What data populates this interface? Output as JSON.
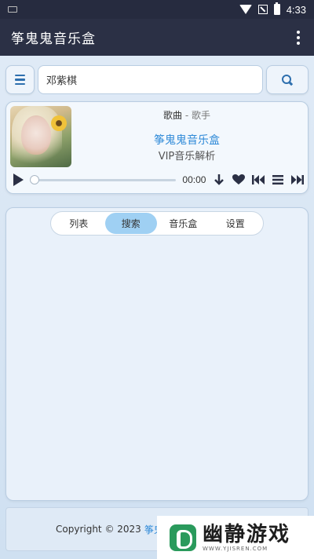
{
  "status_bar": {
    "time": "4:33"
  },
  "app_bar": {
    "title": "筝鬼鬼音乐盒"
  },
  "search": {
    "value": "邓紫棋"
  },
  "player": {
    "song": "歌曲",
    "separator": "-",
    "artist": "歌手",
    "app_name": "筝鬼鬼音乐盒",
    "subtitle": "VIP音乐解析",
    "current_time": "00:00",
    "progress_fraction": 0
  },
  "tabs": [
    {
      "label": "列表",
      "active": false
    },
    {
      "label": "搜索",
      "active": true
    },
    {
      "label": "音乐盒",
      "active": false
    },
    {
      "label": "设置",
      "active": false
    }
  ],
  "footer": {
    "copyright": "Copyright © 2023",
    "link": "筝鬼鬼"
  },
  "watermark": {
    "brand": "幽静游戏",
    "domain": "WWW.YJISREN.COM"
  },
  "colors": {
    "accent": "#2f8ad8",
    "appbar": "#2b3045",
    "active_tab": "#9fd0f3"
  },
  "icons": [
    "keyboard-icon",
    "wifi-icon",
    "sim-icon",
    "battery-icon",
    "more-vert-icon",
    "menu-icon",
    "search-icon",
    "play-icon",
    "download-icon",
    "heart-icon",
    "prev-icon",
    "list-icon",
    "next-icon"
  ]
}
